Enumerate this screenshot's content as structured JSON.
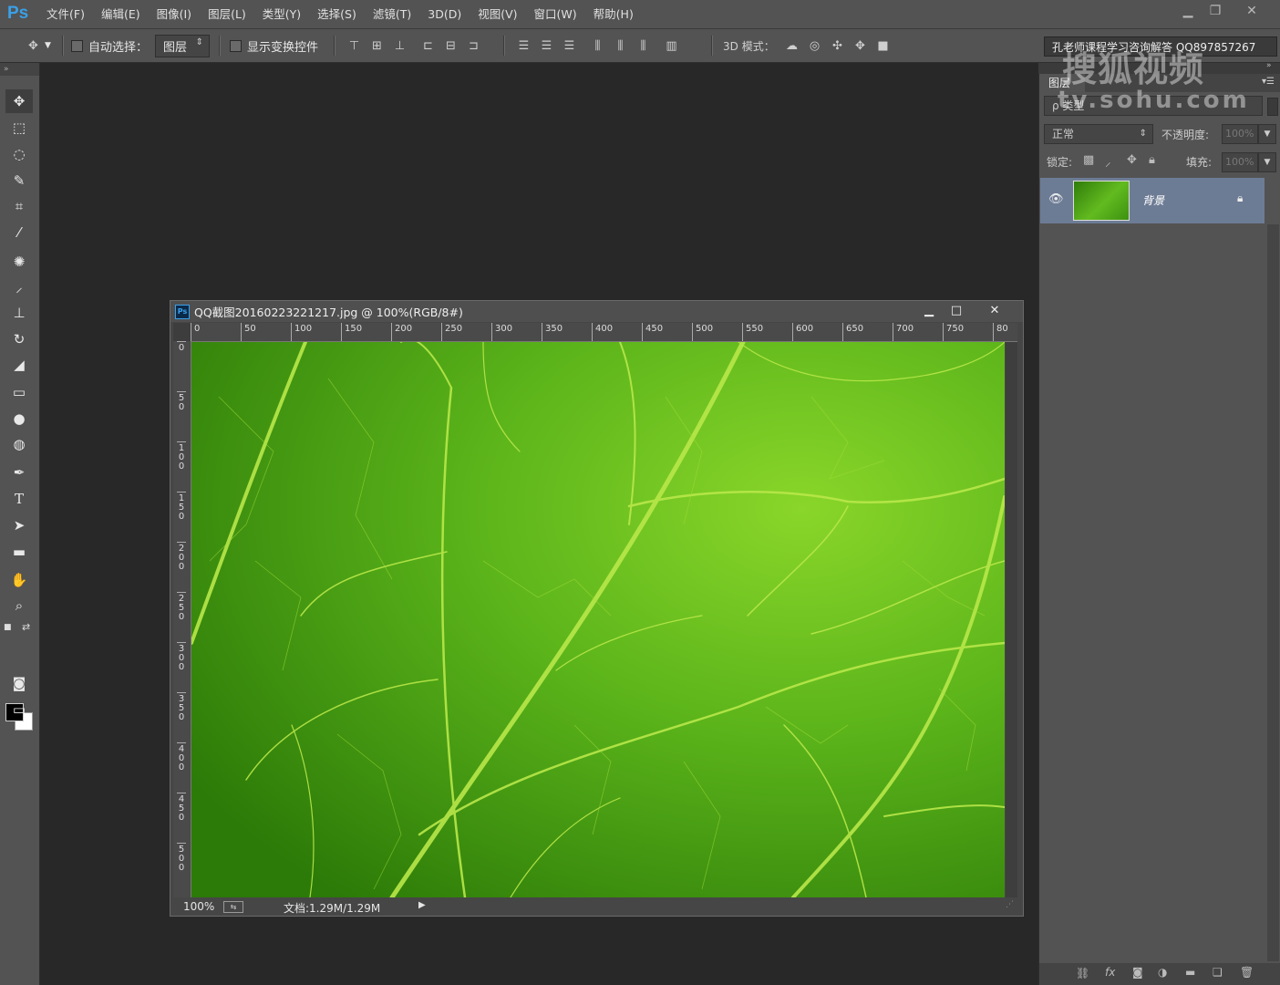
{
  "app": {
    "logo": "Ps",
    "menu": [
      "文件(F)",
      "编辑(E)",
      "图像(I)",
      "图层(L)",
      "类型(Y)",
      "选择(S)",
      "滤镜(T)",
      "3D(D)",
      "视图(V)",
      "窗口(W)",
      "帮助(H)"
    ]
  },
  "options_bar": {
    "auto_select_label": "自动选择：",
    "auto_select_value": "图层",
    "show_transform_label": "显示变换控件",
    "mode_3d_label": "3D 模式：",
    "workspace_text": "孔老师课程学习咨询解答 QQ897857267"
  },
  "watermark": {
    "line1": "搜狐视频",
    "line2": "tv.sohu.com"
  },
  "document": {
    "title": "QQ截图20160223221217.jpg @ 100%(RGB/8#)",
    "h_ruler": [
      "0",
      "50",
      "100",
      "150",
      "200",
      "250",
      "300",
      "350",
      "400",
      "450",
      "500",
      "550",
      "600",
      "650",
      "700",
      "750",
      "80"
    ],
    "v_ruler": [
      "0",
      "50",
      "100",
      "150",
      "200",
      "250",
      "300",
      "350",
      "400",
      "450",
      "500"
    ],
    "zoom": "100%",
    "doc_size": "文档:1.29M/1.29M"
  },
  "layers_panel": {
    "tab": "图层",
    "filter_placeholder": "ρ 类型",
    "blend_mode": "正常",
    "opacity_label": "不透明度:",
    "opacity_value": "100%",
    "lock_label": "锁定:",
    "fill_label": "填充:",
    "fill_value": "100%",
    "layer_name": "背景"
  },
  "colors": {
    "accent": "#3aa0e8",
    "layer_selected": "#6d7c95",
    "leaf_green": "#4ea312"
  }
}
